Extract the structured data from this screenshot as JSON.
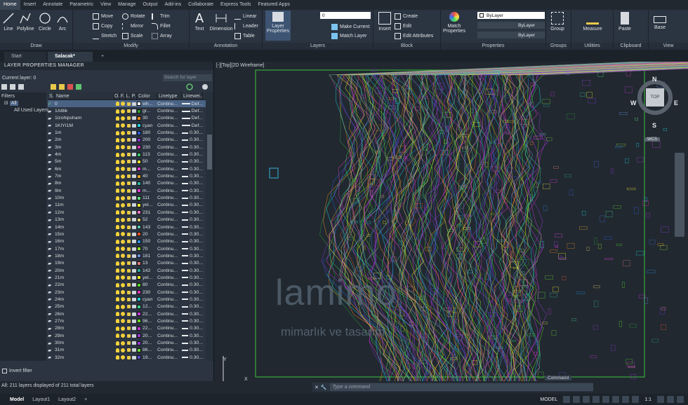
{
  "menu": [
    "Home",
    "Insert",
    "Annotate",
    "Parametric",
    "View",
    "Manage",
    "Output",
    "Add-ins",
    "Collaborate",
    "Express Tools",
    "Featured Apps"
  ],
  "ribbon": {
    "draw": {
      "title": "Draw",
      "line": "Line",
      "polyline": "Polyline",
      "circle": "Circle",
      "arc": "Arc"
    },
    "modify": {
      "title": "Modify",
      "move": "Move",
      "rotate": "Rotate",
      "trim": "Trim",
      "copy": "Copy",
      "mirror": "Mirror",
      "fillet": "Fillet",
      "stretch": "Stretch",
      "scale": "Scale",
      "array": "Array"
    },
    "annotation": {
      "title": "Annotation",
      "text": "Text",
      "dimension": "Dimension",
      "linear": "Linear",
      "leader": "Leader",
      "table": "Table"
    },
    "layers": {
      "title": "Layers",
      "props": "Layer Properties",
      "current": "0",
      "make_current": "Make Current",
      "match_layer": "Match Layer"
    },
    "block": {
      "title": "Block",
      "insert": "Insert",
      "create": "Create",
      "edit": "Edit",
      "edit_attr": "Edit Attributes"
    },
    "properties": {
      "title": "Properties",
      "match": "Match Properties",
      "bylayer1": "ByLayer",
      "bylayer2": "ByLayer",
      "bylayer3": "ByLayer"
    },
    "groups": {
      "title": "Groups",
      "group": "Group"
    },
    "utilities": {
      "title": "Utilities",
      "measure": "Measure"
    },
    "clipboard": {
      "title": "Clipboard",
      "paste": "Paste"
    },
    "view": {
      "title": "View",
      "base": "Base"
    }
  },
  "tabs": [
    "Start",
    "Salacak*"
  ],
  "lpm": {
    "title": "LAYER PROPERTIES MANAGER",
    "current": "Current layer: 0",
    "search_placeholder": "Search for layer",
    "filters_label": "Filters",
    "filter_all": "All",
    "filter_used": "All Used Layers",
    "headers": {
      "s": "S..",
      "name": "Name",
      "o": "O..",
      "f": "F..",
      "l": "L..",
      "p": "P..",
      "color": "Color",
      "linetype": "Linetype",
      "lineweight": "Linewei..."
    },
    "invert": "Invert filter",
    "status": "All: 211 layers displayed of 211 total layers",
    "rows": [
      {
        "name": "0",
        "color": "wh...",
        "hex": "#ffffff",
        "lt": "Continu...",
        "lw": "Def..."
      },
      {
        "name": "1Altlik",
        "color": "gr...",
        "hex": "#2f9e3a",
        "lt": "Continu...",
        "lw": "Def..."
      },
      {
        "name": "1izohipsham",
        "color": "30",
        "hex": "#f28b1a",
        "lt": "Continu...",
        "lw": "Def..."
      },
      {
        "name": "1KIYI1M",
        "color": "cyan",
        "hex": "#1fd3e0",
        "lt": "Continu...",
        "lw": "Def..."
      },
      {
        "name": "1m",
        "color": "180",
        "hex": "#2e5fd9",
        "lt": "Continu...",
        "lw": "0.30..."
      },
      {
        "name": "2m",
        "color": "200",
        "hex": "#8a34d6",
        "lt": "Continu...",
        "lw": "0.30..."
      },
      {
        "name": "3m",
        "color": "230",
        "hex": "#d63ab8",
        "lt": "Continu...",
        "lw": "0.30..."
      },
      {
        "name": "4m",
        "color": "113",
        "hex": "#38c96a",
        "lt": "Continu...",
        "lw": "0.30..."
      },
      {
        "name": "5m",
        "color": "50",
        "hex": "#e8e23a",
        "lt": "Continu...",
        "lw": "0.30..."
      },
      {
        "name": "6m",
        "color": "m...",
        "hex": "#e23fd8",
        "lt": "Continu...",
        "lw": "0.30..."
      },
      {
        "name": "7m",
        "color": "40",
        "hex": "#e5a92a",
        "lt": "Continu...",
        "lw": "0.30..."
      },
      {
        "name": "8m",
        "color": "140",
        "hex": "#2fb8a4",
        "lt": "Continu...",
        "lw": "0.30..."
      },
      {
        "name": "9m",
        "color": "m...",
        "hex": "#e23fd8",
        "lt": "Continu...",
        "lw": "0.30..."
      },
      {
        "name": "10m",
        "color": "111",
        "hex": "#5ee07a",
        "lt": "Continu...",
        "lw": "0.30..."
      },
      {
        "name": "11m",
        "color": "yel...",
        "hex": "#f2ee2a",
        "lt": "Continu...",
        "lw": "0.30..."
      },
      {
        "name": "12m",
        "color": "231",
        "hex": "#e877c9",
        "lt": "Continu...",
        "lw": "0.30..."
      },
      {
        "name": "13m",
        "color": "52",
        "hex": "#d9cf67",
        "lt": "Continu...",
        "lw": "0.30..."
      },
      {
        "name": "14m",
        "color": "143",
        "hex": "#57c6b1",
        "lt": "Continu...",
        "lw": "0.30..."
      },
      {
        "name": "15m",
        "color": "20",
        "hex": "#e8552a",
        "lt": "Continu...",
        "lw": "0.30..."
      },
      {
        "name": "16m",
        "color": "150",
        "hex": "#2a8fe0",
        "lt": "Continu...",
        "lw": "0.30..."
      },
      {
        "name": "17m",
        "color": "70",
        "hex": "#8de02a",
        "lt": "Continu...",
        "lw": "0.30..."
      },
      {
        "name": "18m",
        "color": "181",
        "hex": "#6c8fe0",
        "lt": "Continu...",
        "lw": "0.30..."
      },
      {
        "name": "19m",
        "color": "13",
        "hex": "#e07a7a",
        "lt": "Continu...",
        "lw": "0.30..."
      },
      {
        "name": "20m",
        "color": "142",
        "hex": "#2aa99a",
        "lt": "Continu...",
        "lw": "0.30..."
      },
      {
        "name": "21m",
        "color": "yel...",
        "hex": "#f2ee2a",
        "lt": "Continu...",
        "lw": "0.30..."
      },
      {
        "name": "22m",
        "color": "80",
        "hex": "#5ad62a",
        "lt": "Continu...",
        "lw": "0.30..."
      },
      {
        "name": "23m",
        "color": "230",
        "hex": "#d63ab8",
        "lt": "Continu...",
        "lw": "0.30..."
      },
      {
        "name": "24m",
        "color": "cyan",
        "hex": "#1fd3e0",
        "lt": "Continu...",
        "lw": "0.30..."
      },
      {
        "name": "25m",
        "color": "12...",
        "hex": "#3ad68e",
        "lt": "Continu...",
        "lw": "0.30..."
      },
      {
        "name": "26m",
        "color": "22...",
        "hex": "#c03ad6",
        "lt": "Continu...",
        "lw": "0.30..."
      },
      {
        "name": "27m",
        "color": "96...",
        "hex": "#6ed62a",
        "lt": "Continu...",
        "lw": "0.30..."
      },
      {
        "name": "28m",
        "color": "22...",
        "hex": "#c03ad6",
        "lt": "Continu...",
        "lw": "0.30..."
      },
      {
        "name": "29m",
        "color": "20...",
        "hex": "#9a3ad6",
        "lt": "Continu...",
        "lw": "0.30..."
      },
      {
        "name": "30m",
        "color": "20...",
        "hex": "#9a3ad6",
        "lt": "Continu...",
        "lw": "0.30..."
      },
      {
        "name": "31m",
        "color": "86...",
        "hex": "#6ad63a",
        "lt": "Continu...",
        "lw": "0.30..."
      },
      {
        "name": "32m",
        "color": "19...",
        "hex": "#5a4ad6",
        "lt": "Continu...",
        "lw": "0.30..."
      },
      {
        "name": "33m",
        "color": "18...",
        "hex": "#3a6ad6",
        "lt": "Continu...",
        "lw": "0.30..."
      }
    ]
  },
  "viewport": {
    "label": "[-][Top][2D Wireframe]",
    "top": "TOP",
    "n": "N",
    "s": "S",
    "e": "E",
    "w": "W",
    "wcs": "WCS",
    "x_axis": "X",
    "y_axis": "Y",
    "watermark": "lamimo",
    "watermark_sub": "mimarlık ve tasarım",
    "cmd_tag": "Command"
  },
  "cmd": {
    "placeholder": "Type a command"
  },
  "status": {
    "model": "Model",
    "layout1": "Layout1",
    "layout2": "Layout2",
    "plus": "+",
    "model_btn": "MODEL",
    "scale": "1:1"
  }
}
